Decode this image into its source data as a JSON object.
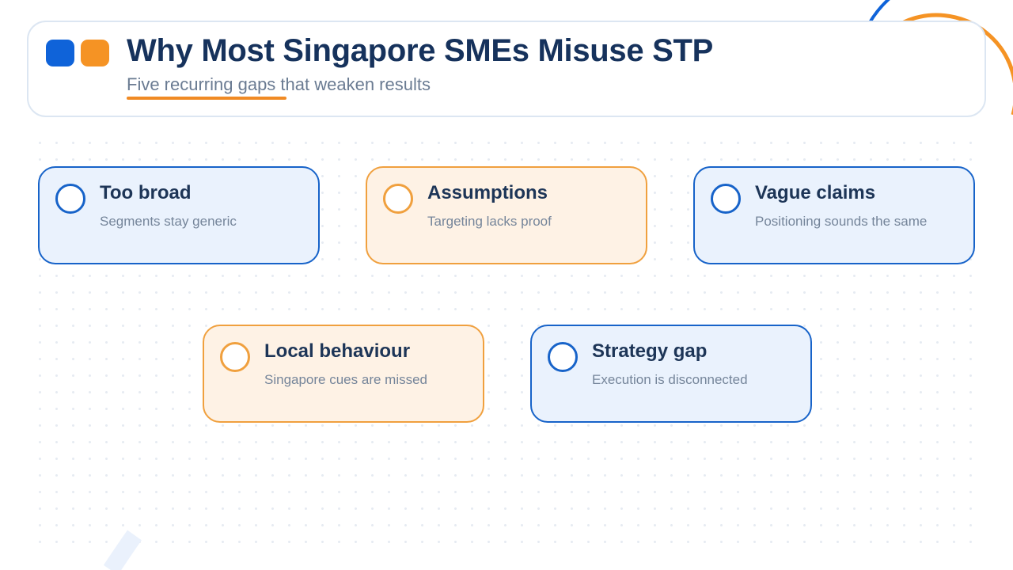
{
  "header": {
    "title": "Why Most Singapore SMEs Misuse STP",
    "subtitle": "Five recurring gaps that weaken results"
  },
  "colors": {
    "primary_blue": "#1763c9",
    "accent_orange": "#f08a24",
    "title_navy": "#16325c"
  },
  "gaps": [
    {
      "title": "Too broad",
      "description": "Segments stay generic",
      "theme": "blue",
      "icon": "circle-ring-icon"
    },
    {
      "title": "Assumptions",
      "description": "Targeting lacks proof",
      "theme": "orange",
      "icon": "circle-ring-icon"
    },
    {
      "title": "Vague claims",
      "description": "Positioning sounds the same",
      "theme": "blue",
      "icon": "circle-ring-icon"
    },
    {
      "title": "Local behaviour",
      "description": "Singapore cues are missed",
      "theme": "orange",
      "icon": "circle-ring-icon"
    },
    {
      "title": "Strategy gap",
      "description": "Execution is disconnected",
      "theme": "blue",
      "icon": "circle-ring-icon"
    }
  ]
}
